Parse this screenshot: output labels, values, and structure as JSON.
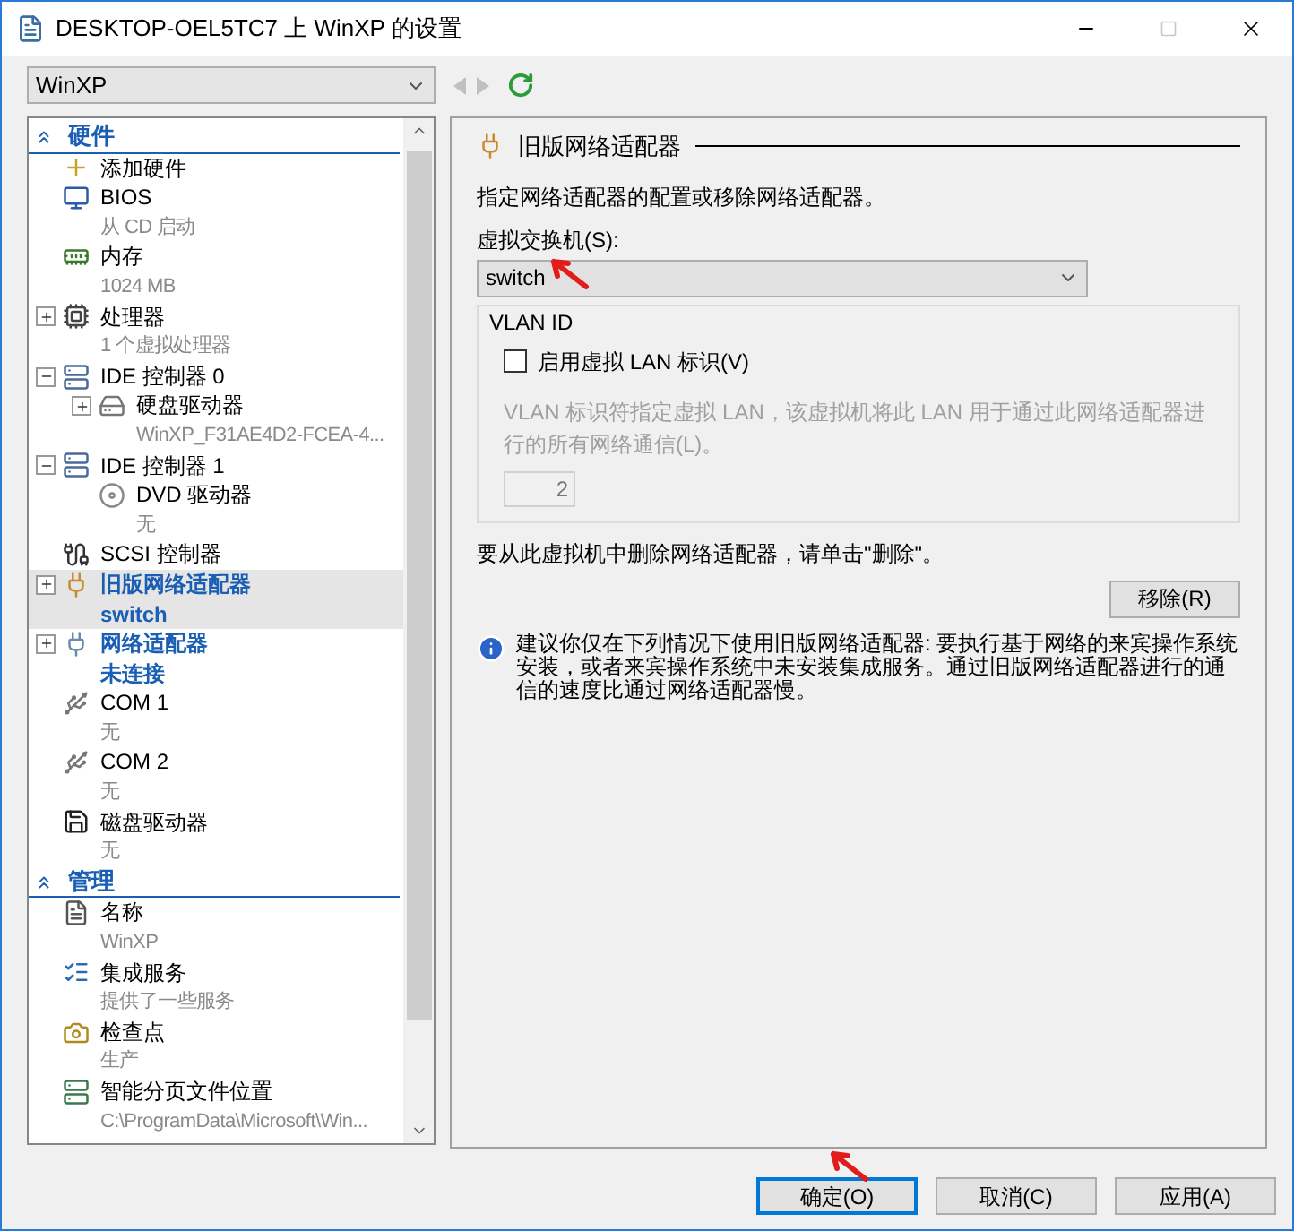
{
  "window": {
    "title": "DESKTOP-OEL5TC7 上 WinXP 的设置",
    "maximize_disabled": true
  },
  "vm_selector": {
    "value": "WinXP"
  },
  "toolbar": {
    "back_disabled": true,
    "forward_disabled": true
  },
  "tree": {
    "sections": [
      {
        "title": "硬件",
        "expanded": true,
        "items": [
          {
            "kind": "add",
            "label": "添加硬件",
            "selected": false
          },
          {
            "kind": "bios",
            "label": "BIOS",
            "detail": "从 CD 启动",
            "selected": false
          },
          {
            "kind": "memory",
            "label": "内存",
            "detail": "1024 MB",
            "selected": false
          },
          {
            "kind": "cpu",
            "label": "处理器",
            "detail": "1 个虚拟处理器",
            "expanded": false,
            "selected": false
          },
          {
            "kind": "ide",
            "label": "IDE 控制器 0",
            "expanded": true,
            "selected": false,
            "children": [
              {
                "kind": "disk",
                "label": "硬盘驱动器",
                "detail": "WinXP_F31AE4D2-FCEA-4...",
                "expanded": false,
                "selected": false
              }
            ]
          },
          {
            "kind": "ide",
            "label": "IDE 控制器 1",
            "expanded": true,
            "selected": false,
            "children": [
              {
                "kind": "dvd",
                "label": "DVD 驱动器",
                "detail": "无",
                "selected": false
              }
            ]
          },
          {
            "kind": "scsi",
            "label": "SCSI 控制器",
            "selected": false
          },
          {
            "kind": "legacy-nic",
            "label": "旧版网络适配器",
            "detail": "switch",
            "expanded": false,
            "selected": true
          },
          {
            "kind": "nic",
            "label": "网络适配器",
            "detail": "未连接",
            "expanded": false,
            "selected": false
          },
          {
            "kind": "com",
            "label": "COM 1",
            "detail": "无",
            "selected": false
          },
          {
            "kind": "com",
            "label": "COM 2",
            "detail": "无",
            "selected": false
          },
          {
            "kind": "floppy",
            "label": "磁盘驱动器",
            "detail": "无",
            "selected": false
          }
        ]
      },
      {
        "title": "管理",
        "expanded": true,
        "items": [
          {
            "kind": "name",
            "label": "名称",
            "detail": "WinXP",
            "selected": false
          },
          {
            "kind": "integration",
            "label": "集成服务",
            "detail": "提供了一些服务",
            "selected": false
          },
          {
            "kind": "checkpoint",
            "label": "检查点",
            "detail": "生产",
            "selected": false
          },
          {
            "kind": "paging",
            "label": "智能分页文件位置",
            "detail": "C:\\ProgramData\\Microsoft\\Win...",
            "selected": false
          }
        ]
      }
    ]
  },
  "panel": {
    "title": "旧版网络适配器",
    "description": "指定网络适配器的配置或移除网络适配器。",
    "switch_label": "虚拟交换机(S):",
    "switch_value": "switch",
    "vlan": {
      "group_title": "VLAN ID",
      "checkbox_label": "启用虚拟 LAN 标识(V)",
      "checked": false,
      "help": "VLAN 标识符指定虚拟 LAN，该虚拟机将此 LAN 用于通过此网络适配器进行的所有网络通信(L)。",
      "value": "2"
    },
    "remove_text": "要从此虚拟机中删除网络适配器，请单击\"删除\"。",
    "remove_button": "移除(R)",
    "info": "建议你仅在下列情况下使用旧版网络适配器: 要执行基于网络的来宾操作系统安装，或者来宾操作系统中未安装集成服务。通过旧版网络适配器进行的通信的速度比通过网络适配器慢。"
  },
  "buttons": [
    {
      "label": "确定(O)",
      "default": true
    },
    {
      "label": "取消(C)",
      "default": false
    },
    {
      "label": "应用(A)",
      "default": false
    }
  ]
}
